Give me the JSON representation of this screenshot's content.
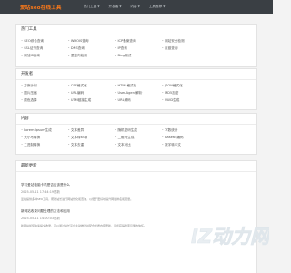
{
  "header": {
    "logo": "爱站seo在线工具",
    "nav": [
      "热门工具",
      "开发者",
      "内容",
      "工具推荐"
    ]
  },
  "sections": [
    {
      "title": "热门工具",
      "items": [
        "SEO综合查询",
        "WHOIS查询",
        "ICP备案查询",
        "网站安全检测",
        "",
        "SSL证书查询",
        "DNS查询",
        "IP查询",
        "反链查询",
        "",
        "网站IP查询",
        "重定向检测",
        "Ping测试",
        "",
        ""
      ]
    },
    {
      "title": "开发者",
      "items": [
        "方案计划",
        "CSS格式化",
        "HTML格式化",
        "JSON格式化",
        "",
        "图片压缩",
        "URL编码",
        "User-Agent解析",
        "MD5加密",
        "",
        "颜色选择",
        "UTM链接生成",
        "URL解码",
        "UUID生成",
        ""
      ]
    },
    {
      "title": "内容",
      "items": [
        "Lorem Ipsum生成",
        "文本差异",
        "随机密码生成",
        "字数统计",
        "",
        "大小写转换",
        "文本转slug",
        "二维码生成",
        "Base64编码",
        "",
        "二进制转换",
        "文本去重",
        "文本对比",
        "数字转中文",
        ""
      ]
    }
  ],
  "updates": {
    "title": "最新更新",
    "entries": [
      {
        "title": "学习爱站电脑卡机是否应该是什么",
        "date": "2025-05-11 17:44:19更新",
        "text": "爱站提供多种SEO工具，帮助站长进行网站优化和查询，以便于更好地提升网站排名和流量。"
      },
      {
        "title": "新网站收录问题处理的方法和应用",
        "date": "2025-05-11 14:00:03更新",
        "text": "新网站如何快速提交收录，可以通过站长平台主动推送并配合优质内容更新，逐步获得搜索引擎的信任。"
      }
    ]
  },
  "watermark": "IZ动力网"
}
